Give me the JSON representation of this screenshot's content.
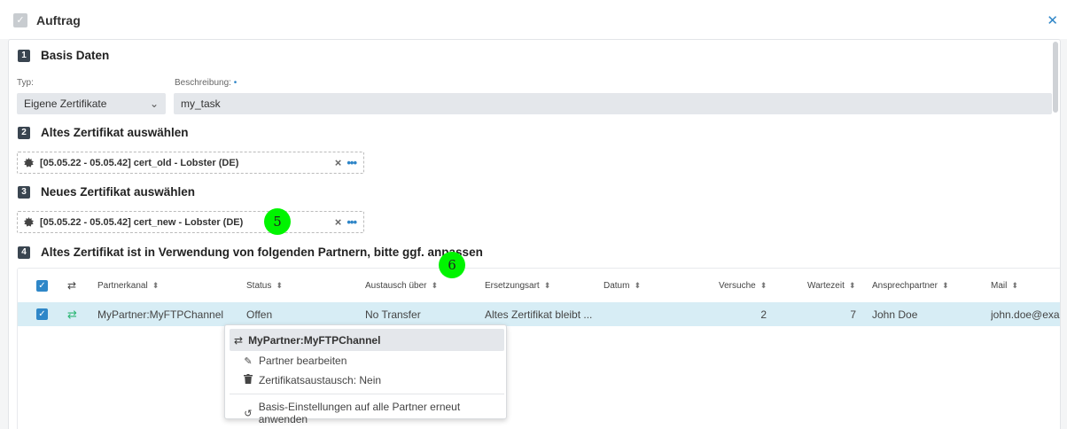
{
  "header": {
    "title": "Auftrag",
    "close_icon": "close-icon"
  },
  "sections": {
    "s1": {
      "num": "1",
      "label": "Basis Daten"
    },
    "s2": {
      "num": "2",
      "label": "Altes Zertifikat auswählen"
    },
    "s3": {
      "num": "3",
      "label": "Neues Zertifikat auswählen"
    },
    "s4": {
      "num": "4",
      "label": "Altes Zertifikat ist in Verwendung von folgenden Partnern, bitte ggf. anpassen"
    }
  },
  "basis": {
    "typ_label": "Typ:",
    "typ_value": "Eigene Zertifikate",
    "beschreibung_label": "Beschreibung:",
    "required_mark": "•",
    "beschreibung_value": "my_task"
  },
  "old_cert": {
    "text": "[05.05.22 - 05.05.42] cert_old - Lobster (DE)"
  },
  "new_cert": {
    "text": "[05.05.22 - 05.05.42] cert_new - Lobster (DE)"
  },
  "markers": {
    "m5": "5",
    "m6": "6"
  },
  "table": {
    "columns": [
      "Partnerkanal",
      "Status",
      "Austausch über",
      "Ersetzungsart",
      "Datum",
      "Versuche",
      "Wartezeit",
      "Ansprechpartner",
      "Mail"
    ],
    "rows": [
      {
        "partnerkanal": "MyPartner:MyFTPChannel",
        "status": "Offen",
        "austausch": "No Transfer",
        "ersetzungsart": "Altes Zertifikat bleibt ...",
        "datum": "",
        "versuche": "2",
        "wartezeit": "7",
        "ansprechpartner": "John Doe",
        "mail": "john.doe@exam"
      }
    ]
  },
  "context_menu": {
    "title": "MyPartner:MyFTPChannel",
    "items": [
      "Partner bearbeiten",
      "Zertifikatsaustausch: Nein",
      "Basis-Einstellungen auf alle Partner erneut anwenden"
    ]
  },
  "colors": {
    "accent": "#2f87c8",
    "row_selected": "#d7edf5",
    "marker": "#00f400"
  }
}
